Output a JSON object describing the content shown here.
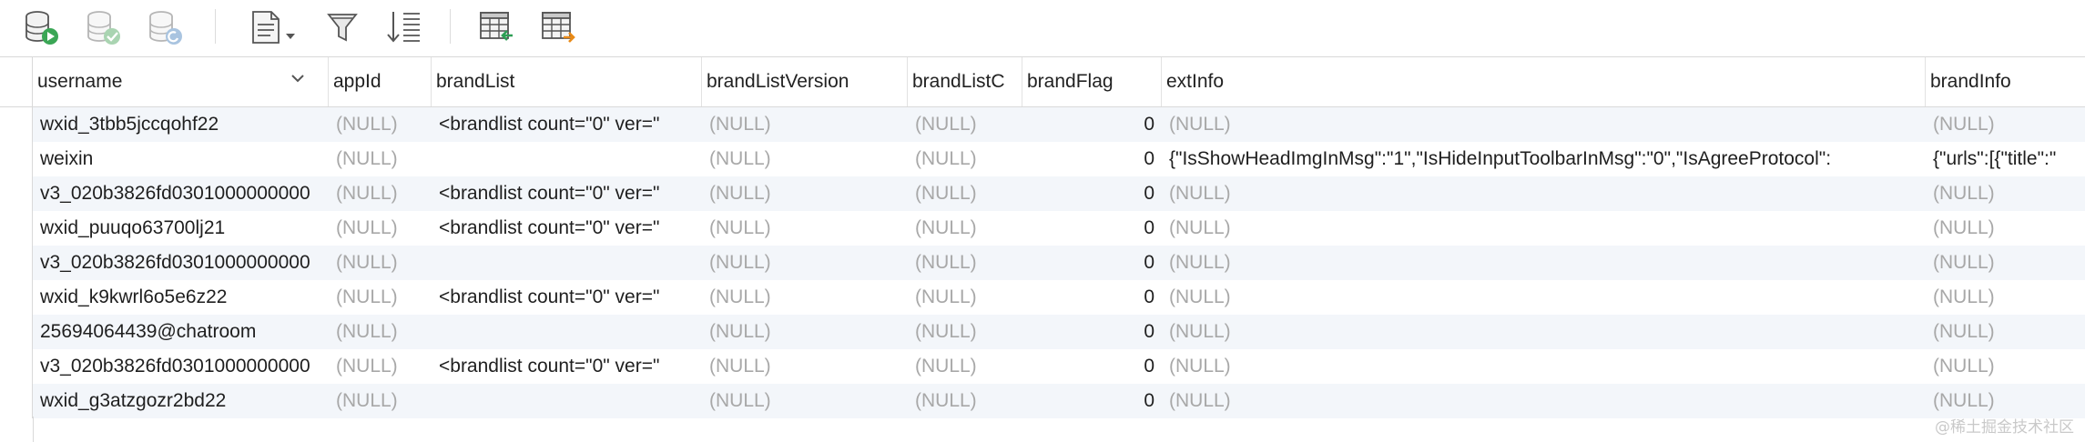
{
  "toolbar": {
    "buttons": [
      {
        "name": "execute-button",
        "icon": "database-play-icon"
      },
      {
        "name": "commit-button",
        "icon": "database-check-icon"
      },
      {
        "name": "rollback-button",
        "icon": "database-revert-icon"
      },
      {
        "name": "text-view-button",
        "icon": "document-dropdown-icon"
      },
      {
        "name": "filter-button",
        "icon": "filter-icon"
      },
      {
        "name": "sort-button",
        "icon": "sort-lines-icon"
      },
      {
        "name": "import-button",
        "icon": "table-import-icon"
      },
      {
        "name": "export-button",
        "icon": "table-export-icon"
      }
    ]
  },
  "table": {
    "columns": [
      {
        "label": "username"
      },
      {
        "label": "appId"
      },
      {
        "label": "brandList"
      },
      {
        "label": "brandListVersion"
      },
      {
        "label": "brandListC"
      },
      {
        "label": "brandFlag"
      },
      {
        "label": "extInfo"
      },
      {
        "label": "brandInfo"
      }
    ],
    "rows": [
      [
        "wxid_3tbb5jccqohf22",
        "(NULL)",
        "<brandlist count=\"0\" ver=\"",
        "(NULL)",
        "(NULL)",
        "0",
        "(NULL)",
        "(NULL)"
      ],
      [
        "weixin",
        "(NULL)",
        "",
        "(NULL)",
        "(NULL)",
        "0",
        "{\"IsShowHeadImgInMsg\":\"1\",\"IsHideInputToolbarInMsg\":\"0\",\"IsAgreeProtocol\":",
        "{\"urls\":[{\"title\":\""
      ],
      [
        "v3_020b3826fd0301000000000",
        "(NULL)",
        "<brandlist count=\"0\" ver=\"",
        "(NULL)",
        "(NULL)",
        "0",
        "(NULL)",
        "(NULL)"
      ],
      [
        "wxid_puuqo63700lj21",
        "(NULL)",
        "<brandlist count=\"0\" ver=\"",
        "(NULL)",
        "(NULL)",
        "0",
        "(NULL)",
        "(NULL)"
      ],
      [
        "v3_020b3826fd0301000000000",
        "(NULL)",
        "",
        "(NULL)",
        "(NULL)",
        "0",
        "(NULL)",
        "(NULL)"
      ],
      [
        "wxid_k9kwrl6o5e6z22",
        "(NULL)",
        "<brandlist count=\"0\" ver=\"",
        "(NULL)",
        "(NULL)",
        "0",
        "(NULL)",
        "(NULL)"
      ],
      [
        "25694064439@chatroom",
        "(NULL)",
        "",
        "(NULL)",
        "(NULL)",
        "0",
        "(NULL)",
        "(NULL)"
      ],
      [
        "v3_020b3826fd0301000000000",
        "(NULL)",
        "<brandlist count=\"0\" ver=\"",
        "(NULL)",
        "(NULL)",
        "0",
        "(NULL)",
        "(NULL)"
      ],
      [
        "wxid_g3atzgozr2bd22",
        "(NULL)",
        "",
        "(NULL)",
        "(NULL)",
        "0",
        "(NULL)",
        "(NULL)"
      ]
    ]
  },
  "watermark": "@稀土掘金技术社区"
}
